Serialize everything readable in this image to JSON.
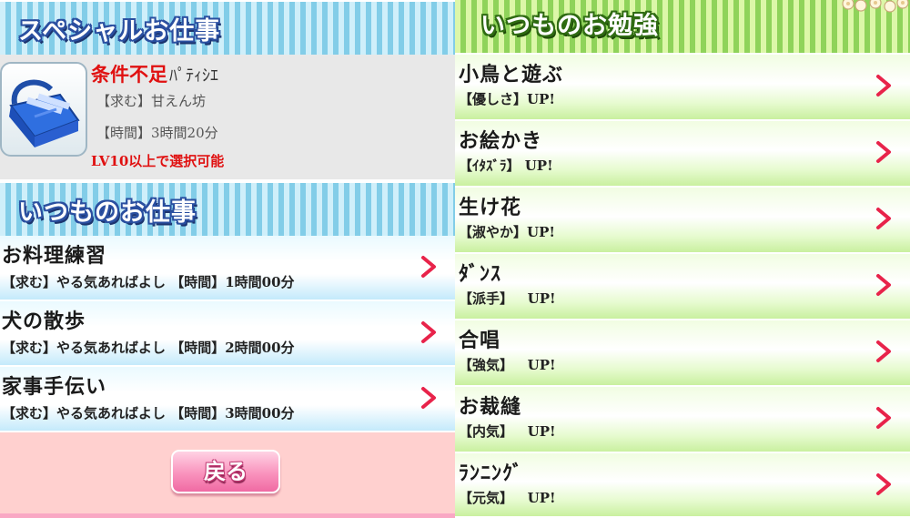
{
  "colors": {
    "accent_red": "#e01010",
    "chevron_red": "#e8234a",
    "blue_banner": "#82cde8",
    "green_banner": "#8fd35a",
    "pink_bg": "#ffd0cf",
    "green_bg": "#d7f7b8"
  },
  "left": {
    "special": {
      "banner_title": "スペシャルお仕事",
      "status": "条件不足",
      "job_name": "ﾊﾟﾃｨｼｴ",
      "requirement": "【求む】甘えん坊",
      "time": "【時間】3時間20分",
      "condition": "LV10以上で選択可能",
      "icon": "bag-icon"
    },
    "regular": {
      "banner_title": "いつものお仕事",
      "jobs": [
        {
          "name": "お料理練習",
          "detail": "【求む】やる気あればよし 【時間】1時間00分"
        },
        {
          "name": "犬の散歩",
          "detail": "【求む】やる気あればよし 【時間】2時間00分"
        },
        {
          "name": "家事手伝い",
          "detail": "【求む】やる気あればよし 【時間】3時間00分"
        }
      ]
    },
    "back_label": "戻る"
  },
  "right": {
    "banner_title": "いつものお勉強",
    "lessons": [
      {
        "name": "小鳥と遊ぶ",
        "detail": "【優しさ】UP!"
      },
      {
        "name": "お絵かき",
        "detail": "【ｲﾀｽﾞﾗ】 UP!"
      },
      {
        "name": "生け花",
        "detail": "【淑やか】UP!"
      },
      {
        "name": "ﾀﾞﾝｽ",
        "detail": "【派手】   UP!"
      },
      {
        "name": "合唱",
        "detail": "【強気】   UP!"
      },
      {
        "name": "お裁縫",
        "detail": "【内気】   UP!"
      },
      {
        "name": "ﾗﾝﾆﾝｸﾞ",
        "detail": "【元気】   UP!"
      }
    ]
  }
}
